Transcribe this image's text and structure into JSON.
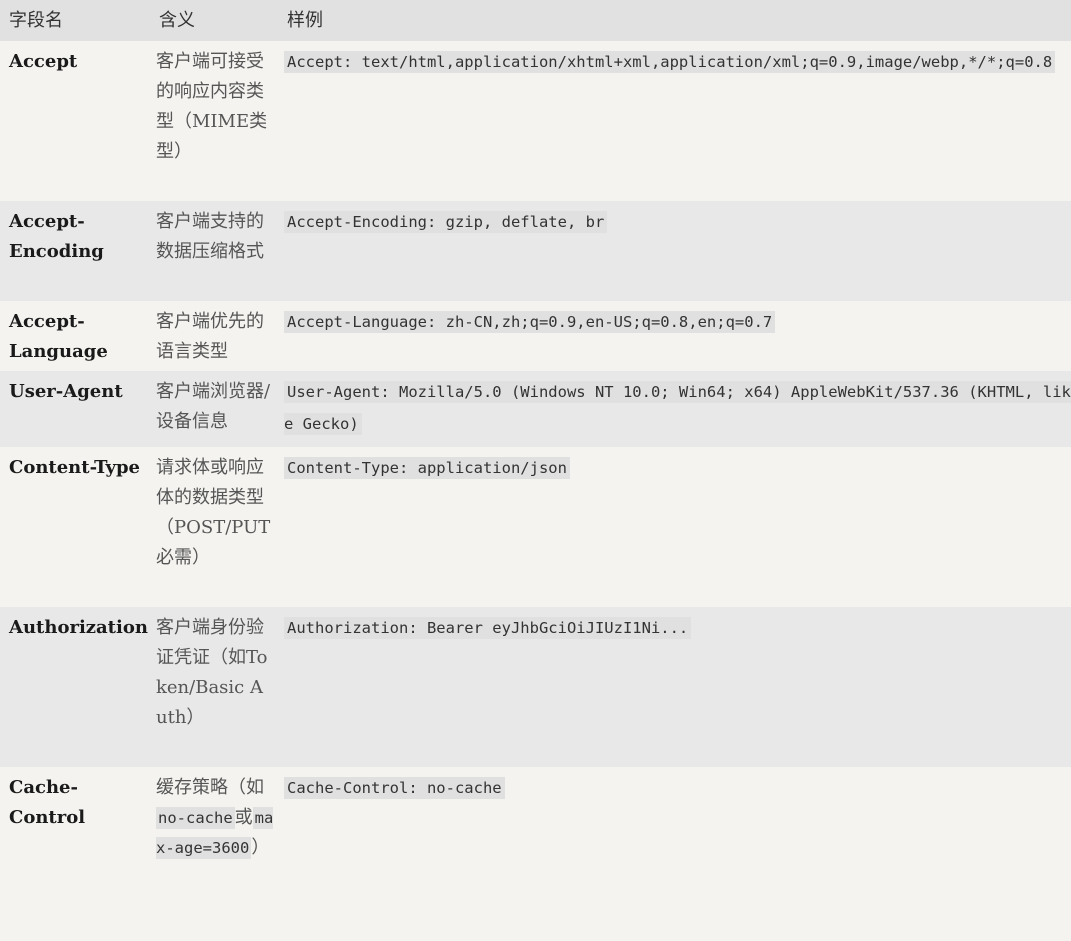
{
  "table": {
    "headers": {
      "field": "字段名",
      "meaning": "含义",
      "example": "样例"
    },
    "rows": [
      {
        "field": "Accept",
        "meaning": "客户端可接受的响应内容类型（MIME类型）",
        "example": "Accept: text/html,application/xhtml+xml,application/xml;q=0.9,image/webp,*/*;q=0.8"
      },
      {
        "field": "Accept-Encoding",
        "meaning": "客户端支持的数据压缩格式",
        "example": "Accept-Encoding: gzip, deflate, br"
      },
      {
        "field": "Accept-Language",
        "meaning": "客户端优先的语言类型",
        "example": "Accept-Language: zh-CN,zh;q=0.9,en-US;q=0.8,en;q=0.7"
      },
      {
        "field": "User-Agent",
        "meaning": "客户端浏览器/设备信息",
        "example": "User-Agent: Mozilla/5.0 (Windows NT 10.0; Win64; x64) AppleWebKit/537.36 (KHTML, like Gecko)"
      },
      {
        "field": "Content-Type",
        "meaning": "请求体或响应体的数据类型（POST/PUT必需）",
        "example": "Content-Type: application/json"
      },
      {
        "field": "Authorization",
        "meaning": "客户端身份验证凭证（如Token/Basic Auth）",
        "example": "Authorization: Bearer eyJhbGciOiJIUzI1Ni..."
      },
      {
        "field": "Cache-Control",
        "meaning_prefix": "缓存策略（如",
        "meaning_code1": "no-cache",
        "meaning_mid": "或",
        "meaning_code2": "max-age=3600",
        "meaning_suffix": "）",
        "example": "Cache-Control: no-cache"
      }
    ]
  }
}
